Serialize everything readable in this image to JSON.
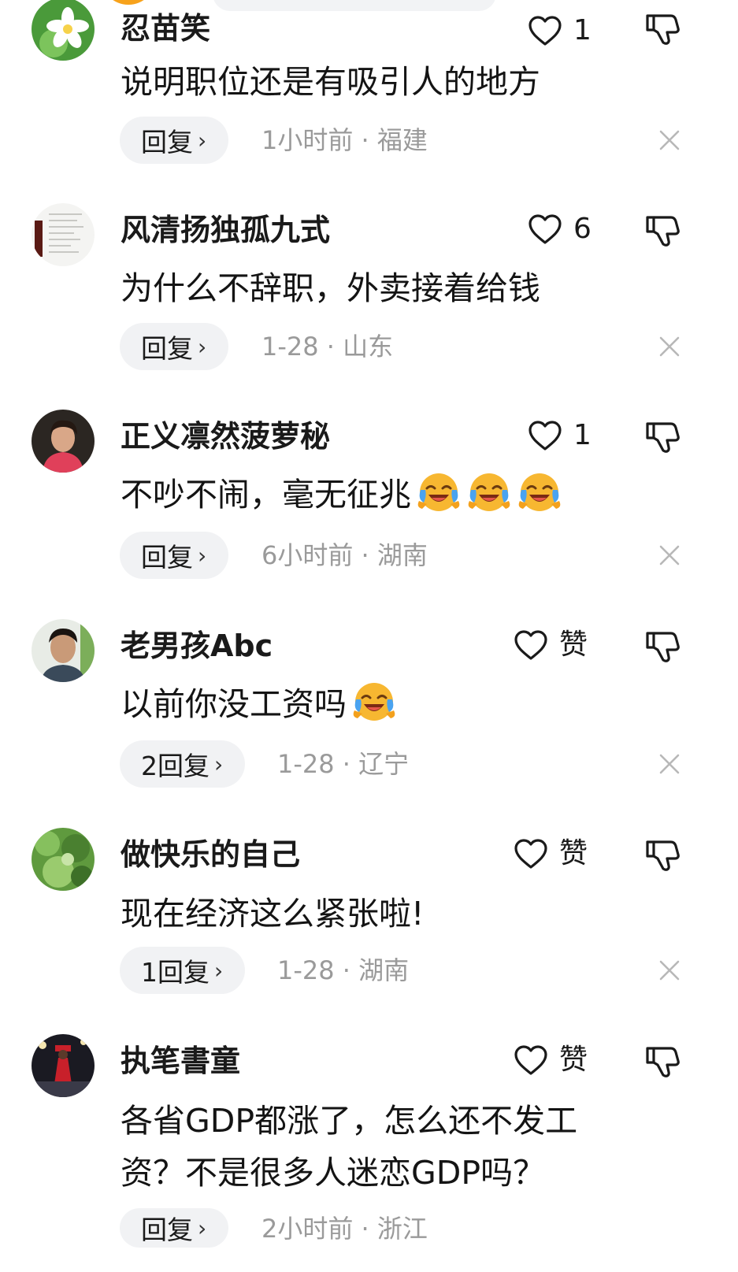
{
  "comments": [
    {
      "username": "忍苗笑",
      "likes": "1",
      "text": "说明职位还是有吸引人的地方",
      "reply_label": "回复",
      "meta": "1小时前 · 福建"
    },
    {
      "username": "风清扬独孤九式",
      "likes": "6",
      "text": "为什么不辞职，外卖接着给钱",
      "reply_label": "回复",
      "meta": "1-28 · 山东"
    },
    {
      "username": "正义凛然菠萝秘",
      "likes": "1",
      "text": "不吵不闹，毫无征兆",
      "reply_label": "回复",
      "meta": "6小时前 · 湖南"
    },
    {
      "username": "老男孩Abc",
      "likes": "赞",
      "text": "以前你没工资吗",
      "reply_label": "2回复",
      "meta": "1-28 · 辽宁"
    },
    {
      "username": "做快乐的自己",
      "likes": "赞",
      "text": "现在经济这么紧张啦!",
      "reply_label": "1回复",
      "meta": "1-28 · 湖南"
    },
    {
      "username": "执笔書童",
      "likes": "赞",
      "text": "各省GDP都涨了，怎么还不发工资？不是很多人迷恋GDP吗？",
      "reply_label": "回复",
      "meta": "2小时前 · 浙江"
    }
  ],
  "icons": {
    "like": "heart-outline-icon",
    "dislike": "thumbs-down-icon",
    "close": "close-icon",
    "chevron": "chevron-right-icon",
    "emoji": "laughing-crying-emoji"
  },
  "colors": {
    "text": "#1a1a1a",
    "meta": "#9a9a9a",
    "pill_bg": "#f1f2f4",
    "emoji_face": "#f7b731",
    "emoji_tears": "#4aa3f0"
  }
}
